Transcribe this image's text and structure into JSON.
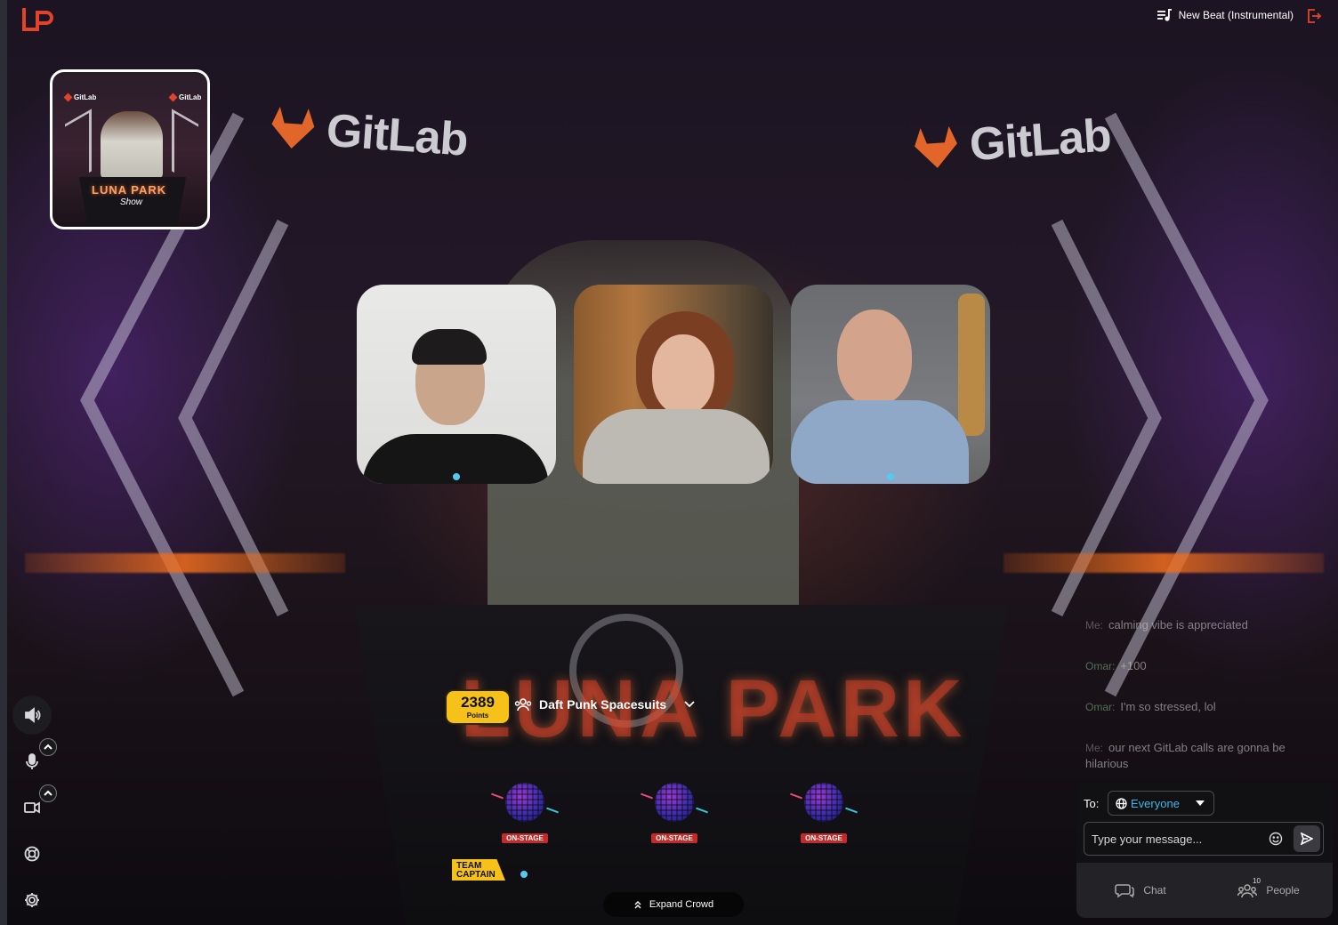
{
  "app": {
    "logo_text": "LP"
  },
  "topbar": {
    "beat_label": "New Beat (Instrumental)",
    "beat_icon": "music-playlist-icon",
    "exit_icon": "exit-icon"
  },
  "stage": {
    "backdrop_brand": "GitLab",
    "sign_text": "LUNA PARK",
    "preview": {
      "brand": "GitLab",
      "title": "LUNA PARK",
      "subtitle": "Show"
    }
  },
  "participants": [
    {
      "name": "participant-1",
      "status_color": "#55c9f0"
    },
    {
      "name": "participant-2",
      "status_color": ""
    },
    {
      "name": "participant-3",
      "status_color": "#55c9f0"
    }
  ],
  "team": {
    "points": "2389",
    "points_label": "Points",
    "name": "Daft Punk Spacesuits",
    "captain_label_1": "TEAM",
    "captain_label_2": "CAPTAIN",
    "slots": [
      {
        "tag": "ON-STAGE"
      },
      {
        "tag": "ON-STAGE"
      },
      {
        "tag": "ON-STAGE"
      }
    ],
    "expand_label": "Expand Crowd"
  },
  "controls": [
    "speaker-icon",
    "microphone-icon",
    "camera-icon",
    "help-icon",
    "settings-icon"
  ],
  "chat": {
    "messages": [
      {
        "sender": "Me:",
        "text": "calming vibe is appreciated"
      },
      {
        "sender": "Omar:",
        "text": "+100"
      },
      {
        "sender": "Omar:",
        "text": "I'm so stressed, lol"
      },
      {
        "sender": "Me:",
        "text": "our next GitLab calls are gonna be hilarious"
      }
    ],
    "to_label": "To:",
    "recipient": "Everyone",
    "input_placeholder": "Type your message...",
    "tabs": [
      {
        "label": "Chat",
        "icon": "chat-icon"
      },
      {
        "label": "People",
        "icon": "people-icon",
        "badge": "10"
      }
    ]
  },
  "colors": {
    "accent": "#3fb7e8",
    "points_yellow": "#f6c21a",
    "brand_red": "#e2432a"
  }
}
